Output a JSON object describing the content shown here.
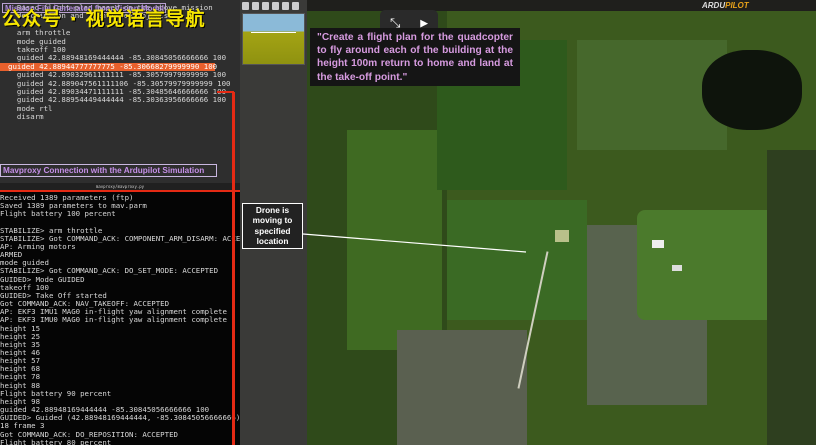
{
  "watermark": "公众号 · 视觉语言导航",
  "terminal_top": {
    "title": "Mission File Generated from Vision Model",
    "lines": [
      "  Based flight plan based on the above mission",
      "  description and identified objects:",
      "",
      "  arm throttle",
      "  mode guided",
      "  takeoff 100",
      "  guided 42.88948169444444 -85.30845056666666 100"
    ],
    "highlighted": "guided 42.88944777777775 -85.30668279999990 100",
    "lines2": [
      "  guided 42.89032961111111 -85.30579979999999 100",
      "  guided 42.889047561111106 -85.30579979999999 100",
      "  guided 42.89034471111111 -85.30485646666666 100",
      "  guided 42.88954449444444 -85.30363956666666 100",
      "  mode rtl",
      "  disarm"
    ]
  },
  "mavproxy_label": "Mavproxy Connection with the Ardupilot Simulation",
  "terminal_bar": "mavproxy/mavproxy.py",
  "terminal_bottom": [
    "Received 1389 parameters (ftp)",
    "Saved 1389 parameters to mav.parm",
    "Flight battery 100 percent",
    "",
    "STABILIZE> arm throttle",
    "STABILIZE> Got COMMAND_ACK: COMPONENT_ARM_DISARM: ACCEPTED",
    "AP: Arming motors",
    "ARMED",
    "mode guided",
    "STABILIZE> Got COMMAND_ACK: DO_SET_MODE: ACCEPTED",
    "GUIDED> Mode GUIDED",
    "takeoff 100",
    "GUIDED> Take Off started",
    "Got COMMAND_ACK: NAV_TAKEOFF: ACCEPTED",
    "AP: EKF3 IMU1 MAG0 in-flight yaw alignment complete",
    "AP: EKF3 IMU0 MAG0 in-flight yaw alignment complete",
    "height 15",
    "height 25",
    "height 35",
    "height 46",
    "height 57",
    "height 68",
    "height 78",
    "height 88",
    "Flight battery 90 percent",
    "height 98",
    "guided 42.88948169444444 -85.30845056666666 100",
    "GUIDED> Guided (42.88948169444444, -85.30845056666666) 100",
    "18 frame 3",
    "Got COMMAND_ACK: DO_REPOSITION: ACCEPTED",
    "Flight battery 80 percent"
  ],
  "prompt": "\"Create a flight plan for the quadcopter to fly around each of the building at the height 100m return to home and land at the take-off point.\"",
  "drone_label": "Drone is moving to specified location",
  "logo": {
    "a": "ARDU",
    "b": "PILOT"
  },
  "colors": {
    "accent_red": "#e52a14",
    "highlight": "#e8602c",
    "label_purple": "#c58fe8"
  }
}
